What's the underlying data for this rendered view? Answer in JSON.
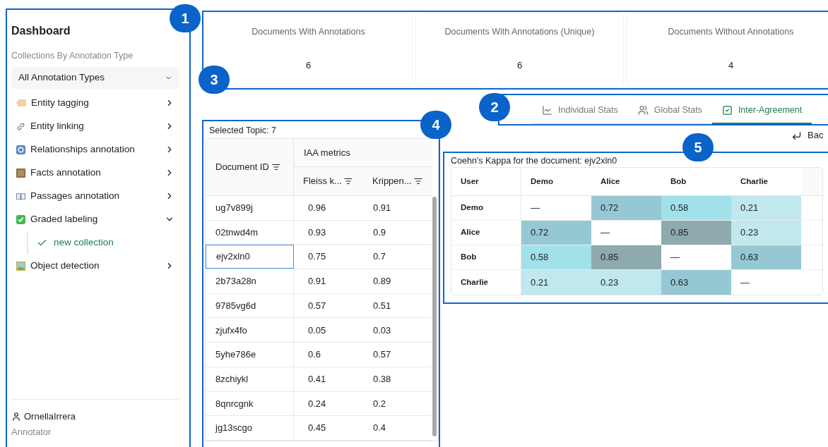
{
  "sidebar": {
    "title": "Dashboard",
    "section_label": "Collections By Annotation Type",
    "filter": {
      "value": "All Annotation Types"
    },
    "items": [
      {
        "label": "Entity tagging",
        "kind": "tag",
        "expanded": false
      },
      {
        "label": "Entity linking",
        "kind": "link",
        "expanded": false
      },
      {
        "label": "Relationships annotation",
        "kind": "cycle",
        "expanded": false
      },
      {
        "label": "Facts annotation",
        "kind": "scroll",
        "expanded": false
      },
      {
        "label": "Passages annotation",
        "kind": "book",
        "expanded": false
      },
      {
        "label": "Graded labeling",
        "kind": "check",
        "expanded": true,
        "children": [
          {
            "label": "new collection",
            "selected": true
          }
        ]
      },
      {
        "label": "Object detection",
        "kind": "picture",
        "expanded": false
      }
    ],
    "user": {
      "name": "OrnellaIrrera",
      "role": "Annotator"
    }
  },
  "callouts": [
    {
      "label": "1"
    },
    {
      "label": "2"
    },
    {
      "label": "3"
    },
    {
      "label": "4"
    },
    {
      "label": "5"
    }
  ],
  "stats": [
    {
      "title": "Documents With Annotations",
      "value": "6"
    },
    {
      "title": "Documents With Annotations (Unique)",
      "value": "6"
    },
    {
      "title": "Documents Without Annotations",
      "value": "4"
    }
  ],
  "tabs": [
    {
      "label": "Individual Stats",
      "kind": "chart",
      "selected": false
    },
    {
      "label": "Global Stats",
      "kind": "users",
      "selected": false
    },
    {
      "label": "Inter-Agreement",
      "kind": "check",
      "selected": true
    }
  ],
  "back": "Bac",
  "documents": {
    "caption": "Selected Topic: 7",
    "group_header": "IAA metrics",
    "columns": [
      "Document ID",
      "Fleiss k...",
      "Krippen..."
    ],
    "rows": [
      {
        "id": "ug7v899j",
        "fleiss": "0.96",
        "krippendorff": "0.91",
        "selected": false
      },
      {
        "id": "02tnwd4m",
        "fleiss": "0.93",
        "krippendorff": "0.9",
        "selected": false
      },
      {
        "id": "ejv2xln0",
        "fleiss": "0.75",
        "krippendorff": "0.7",
        "selected": true
      },
      {
        "id": "2b73a28n",
        "fleiss": "0.91",
        "krippendorff": "0.89",
        "selected": false
      },
      {
        "id": "9785vg6d",
        "fleiss": "0.57",
        "krippendorff": "0.51",
        "selected": false
      },
      {
        "id": "zjufx4fo",
        "fleiss": "0.05",
        "krippendorff": "0.03",
        "selected": false
      },
      {
        "id": "5yhe786e",
        "fleiss": "0.6",
        "krippendorff": "0.57",
        "selected": false
      },
      {
        "id": "8zchiykl",
        "fleiss": "0.41",
        "krippendorff": "0.38",
        "selected": false
      },
      {
        "id": "8qnrcgnk",
        "fleiss": "0.24",
        "krippendorff": "0.2",
        "selected": false
      },
      {
        "id": "jg13scgo",
        "fleiss": "0.45",
        "krippendorff": "0.4",
        "selected": false
      }
    ]
  },
  "kappa": {
    "title": "Coehn's Kappa for the document: ejv2xln0",
    "corner": "User",
    "columns": [
      "Demo",
      "Alice",
      "Bob",
      "Charlie"
    ],
    "rows": [
      {
        "user": "Demo",
        "cells": [
          {
            "value": "—",
            "color": "#ffffff"
          },
          {
            "value": "0.72",
            "color": "#96c8d4"
          },
          {
            "value": "0.58",
            "color": "#a2e0ea"
          },
          {
            "value": "0.21",
            "color": "#c0e8ee"
          }
        ]
      },
      {
        "user": "Alice",
        "cells": [
          {
            "value": "0.72",
            "color": "#96c8d4"
          },
          {
            "value": "—",
            "color": "#ffffff"
          },
          {
            "value": "0.85",
            "color": "#8eaaaf"
          },
          {
            "value": "0.23",
            "color": "#c0e8ee"
          }
        ]
      },
      {
        "user": "Bob",
        "cells": [
          {
            "value": "0.58",
            "color": "#a2e0ea"
          },
          {
            "value": "0.85",
            "color": "#8eaaaf"
          },
          {
            "value": "—",
            "color": "#ffffff"
          },
          {
            "value": "0.63",
            "color": "#96c8d4"
          }
        ]
      },
      {
        "user": "Charlie",
        "cells": [
          {
            "value": "0.21",
            "color": "#c0e8ee"
          },
          {
            "value": "0.23",
            "color": "#c0e8ee"
          },
          {
            "value": "0.63",
            "color": "#96c8d4"
          },
          {
            "value": "—",
            "color": "#ffffff"
          }
        ]
      }
    ]
  }
}
